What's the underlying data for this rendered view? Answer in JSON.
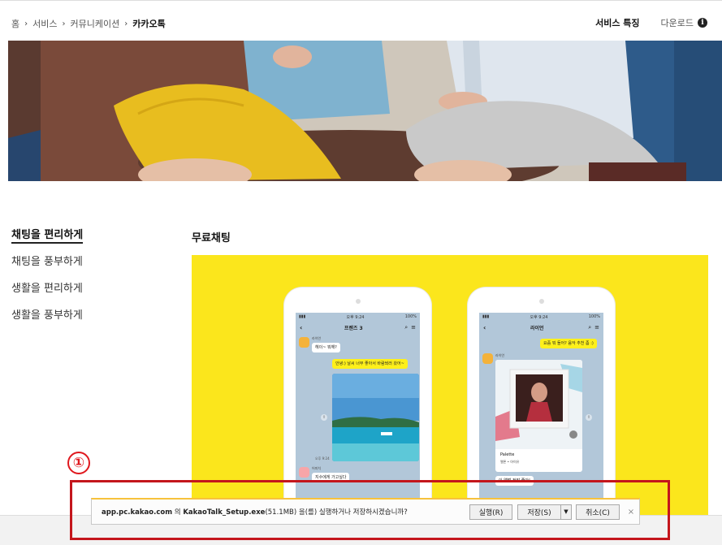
{
  "breadcrumb": {
    "items": [
      "홈",
      "서비스",
      "커뮤니케이션",
      "카카오톡"
    ],
    "separator": "›"
  },
  "topnav": {
    "feature_label": "서비스 특징",
    "download_label": "다운로드"
  },
  "sidemenu": {
    "items": [
      {
        "label": "채팅을 편리하게",
        "active": true
      },
      {
        "label": "채팅을 풍부하게",
        "active": false
      },
      {
        "label": "생활을 편리하게",
        "active": false
      },
      {
        "label": "생활을 풍부하게",
        "active": false
      }
    ]
  },
  "section": {
    "title": "무료채팅"
  },
  "phone1": {
    "time": "오후 9:24",
    "battery": "100%",
    "chat_title": "프렌즈 3",
    "sender_name": "라이언",
    "msg1": "헤이~ 뭐해?",
    "msg2": "안녕:) 날씨 너무 좋아서 바람쐬러 왔어~",
    "time1": "오후 9:24",
    "sender2_name": "어피치",
    "msg3": "지수에게 가고싶다"
  },
  "phone2": {
    "time": "오후 9:24",
    "battery": "100%",
    "chat_title": "라이언",
    "msg1": "요즘 뭐 들어? 음악 추천 좀 :)",
    "sender_name": "라이언",
    "card_title": "Palette",
    "card_sub": "멜론 • 아이유",
    "msg2": "이 앨범 정말 좋아!"
  },
  "download_bar": {
    "site": "app.pc.kakao.com",
    "message_mid": " 의 ",
    "filename": "KakaoTalk_Setup.exe",
    "message_rest": "(51.1MB) 을(를) 실행하거나 저장하시겠습니까?",
    "run_label": "실행(R)",
    "save_label": "저장(S)",
    "cancel_label": "취소(C)",
    "close_label": "×"
  },
  "annotation": {
    "number": "①",
    "color": "#c4161c"
  },
  "colors": {
    "kakao_yellow": "#fbe61c",
    "chat_bg": "#b2c7d9",
    "bubble_yellow": "#fef01b"
  }
}
